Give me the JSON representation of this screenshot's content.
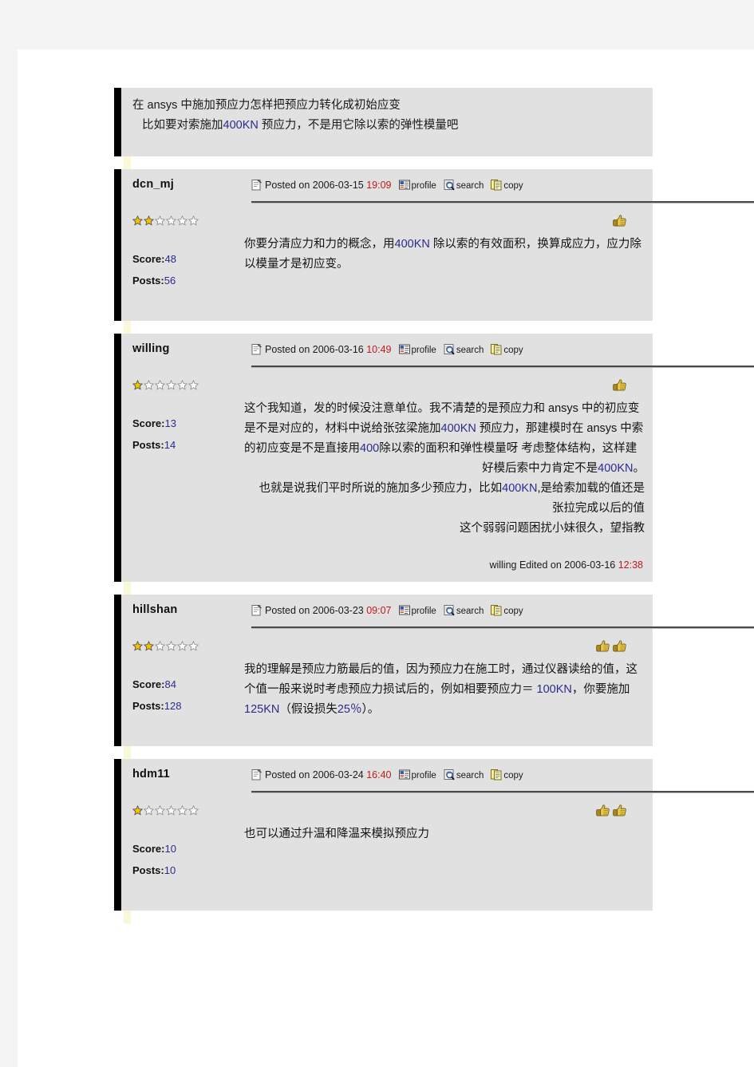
{
  "thread": {
    "question": {
      "lines": [
        "在 ansys 中施加预应力怎样把预应力转化成初始应变",
        "比如要对索施加400KN 预应力，不是用它除以索的弹性模量吧"
      ]
    },
    "labels": {
      "posted_on": "Posted on",
      "profile": "profile",
      "search": "search",
      "copy": "copy",
      "score": "Score:",
      "posts": "Posts:",
      "edited_on": "Edited on"
    },
    "icons": {
      "note": "note-icon",
      "profile": "profile-icon",
      "search": "search-icon",
      "copy": "copy-icon",
      "star_filled": "star-filled-icon",
      "star_empty": "star-empty-icon",
      "thumbs_up": "thumbs-up-icon"
    },
    "colors": {
      "time": "#c01a1a",
      "number": "#2b2b8f",
      "panel": "#e1e1e1",
      "bar": "#000000",
      "marker": "#fbf8d8"
    },
    "posts": [
      {
        "user": "dcn_mj",
        "date": "2006-03-15",
        "time": "19:09",
        "stars_filled": 2,
        "stars_total": 6,
        "score": "48",
        "posts_count": "56",
        "hands": 1,
        "body_lines": [
          "你要分清应力和力的概念，用400KN 除以索的有效面积，换算成应力，应力除",
          "以模量才是初应变。"
        ],
        "body_align": [
          "left",
          "left"
        ],
        "edited": null
      },
      {
        "user": "willing",
        "date": "2006-03-16",
        "time": "10:49",
        "stars_filled": 1,
        "stars_total": 6,
        "score": "13",
        "posts_count": "14",
        "hands": 1,
        "body_lines": [
          "这个我知道，发的时候没注意单位。我不清楚的是预应力和 ansys 中的初应变",
          "是不是对应的，材料中说给张弦梁施加400KN 预应力，那建模时在 ansys 中索",
          "的初应变是不是直接用400除以索的面积和弹性模量呀 考虑整体结构，这样建",
          "好模后索中力肯定不是400KN。",
          "也就是说我们平时所说的施加多少预应力，比如400KN,是给索加载的值还是",
          "张拉完成以后的值",
          "这个弱弱问题困扰小妹很久，望指教"
        ],
        "body_align": [
          "left",
          "left",
          "left",
          "right",
          "right",
          "right",
          "right"
        ],
        "edited": {
          "user": "willing",
          "date": "2006-03-16",
          "time": "12:38"
        }
      },
      {
        "user": "hillshan",
        "date": "2006-03-23",
        "time": "09:07",
        "stars_filled": 2,
        "stars_total": 6,
        "score": "84",
        "posts_count": "128",
        "hands": 2,
        "body_lines": [
          "我的理解是预应力筋最后的值，因为预应力在施工时，通过仪器读给的值，这",
          "个值一般来说时考虑预应力损试后的，例如相要预应力＝ 100KN，你要施加",
          "125KN（假设损失25％）。"
        ],
        "body_align": [
          "left",
          "left",
          "left"
        ],
        "edited": null
      },
      {
        "user": "hdm11",
        "date": "2006-03-24",
        "time": "16:40",
        "stars_filled": 1,
        "stars_total": 6,
        "score": "10",
        "posts_count": "10",
        "hands": 2,
        "body_lines": [
          "也可以通过升温和降温来模拟预应力"
        ],
        "body_align": [
          "left"
        ],
        "edited": null
      }
    ]
  }
}
